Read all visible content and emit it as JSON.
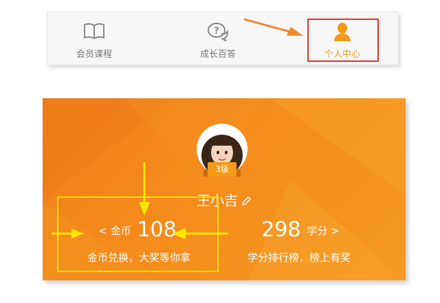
{
  "tabs": [
    {
      "label": "会员课程",
      "icon": "book-icon"
    },
    {
      "label": "成长百答",
      "icon": "question-bubble-icon"
    },
    {
      "label": "个人中心",
      "icon": "person-icon",
      "active": true
    }
  ],
  "profile": {
    "level": "3级",
    "username": "王小吉"
  },
  "coins": {
    "chevron": "<",
    "label": "金币",
    "value": "108",
    "description": "金币兑换，大奖等你拿"
  },
  "points": {
    "value": "298",
    "label": "学分",
    "chevron": ">",
    "description": "学分排行榜，榜上有奖"
  },
  "colors": {
    "accent_orange": "#f39a19",
    "banner_orange": "#f58a1c",
    "annotation_red": "#e03030",
    "annotation_yellow": "#ffe600"
  }
}
